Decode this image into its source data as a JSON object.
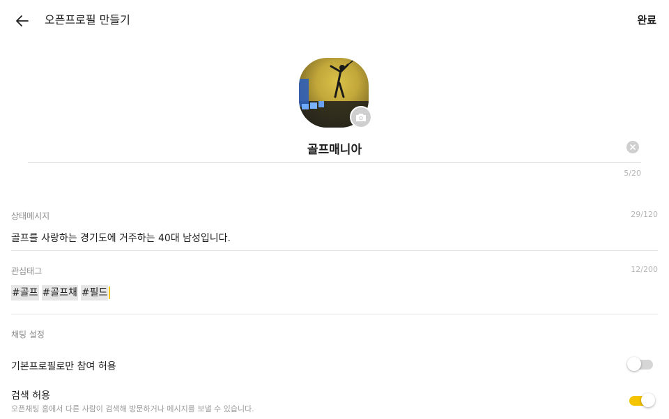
{
  "header": {
    "title": "오픈프로필 만들기",
    "done_label": "완료"
  },
  "profile": {
    "name_value": "골프매니아",
    "name_count": "5/20"
  },
  "status": {
    "label": "상태메시지",
    "count": "29/120",
    "text": "골프를 사랑하는 경기도에 거주하는 40대 남성입니다."
  },
  "interest_tags": {
    "label": "관심태그",
    "count": "12/200",
    "tags": [
      "#골프",
      "#골프채",
      "#필드"
    ]
  },
  "chat_settings": {
    "label": "채팅 설정",
    "basic_profile_only": {
      "label": "기본프로필로만 참여 허용",
      "enabled": false
    },
    "search_allow": {
      "label": "검색 허용",
      "description": "오픈채팅 홈에서 다른 사람이 검색해 방문하거나 메시지를 보낼 수 있습니다.",
      "enabled": true
    }
  },
  "icons": {
    "back": "arrow-left-icon",
    "camera": "camera-icon",
    "clear": "clear-icon"
  },
  "colors": {
    "accent_yellow": "#f5c400",
    "toggle_off_track": "#d6d6d6"
  }
}
